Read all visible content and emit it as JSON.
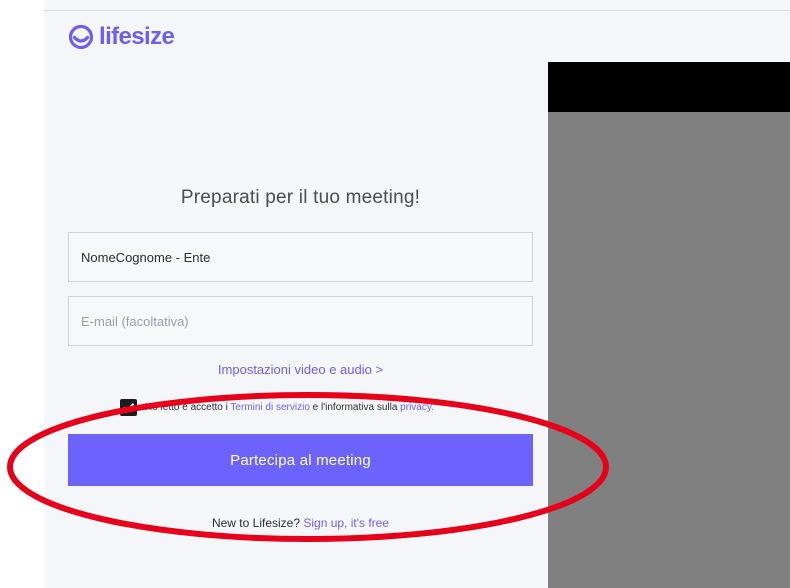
{
  "brand": {
    "name": "lifesize",
    "color": "#6c5ff6",
    "icon": "lifesize-logo-icon"
  },
  "form": {
    "heading": "Preparati per il tuo meeting!",
    "name_field": {
      "value": "NomeCognome - Ente",
      "placeholder": ""
    },
    "email_field": {
      "value": "",
      "placeholder": "E-mail (facoltativa)"
    },
    "settings_link": "Impostazioni video e audio >",
    "consent": {
      "checked": true,
      "text_prefix": "Ho letto e accetto i ",
      "terms_link": "Termini di servizio",
      "text_mid": " e l'informativa sulla ",
      "privacy_link": "privacy."
    },
    "join_button": "Partecipa al meeting",
    "signup": {
      "prefix": "New to Lifesize?",
      "link": "Sign up, it's free"
    }
  },
  "colors": {
    "accent": "#6c63ff",
    "annotation": "#e8001b",
    "video_bg": "#808080"
  }
}
